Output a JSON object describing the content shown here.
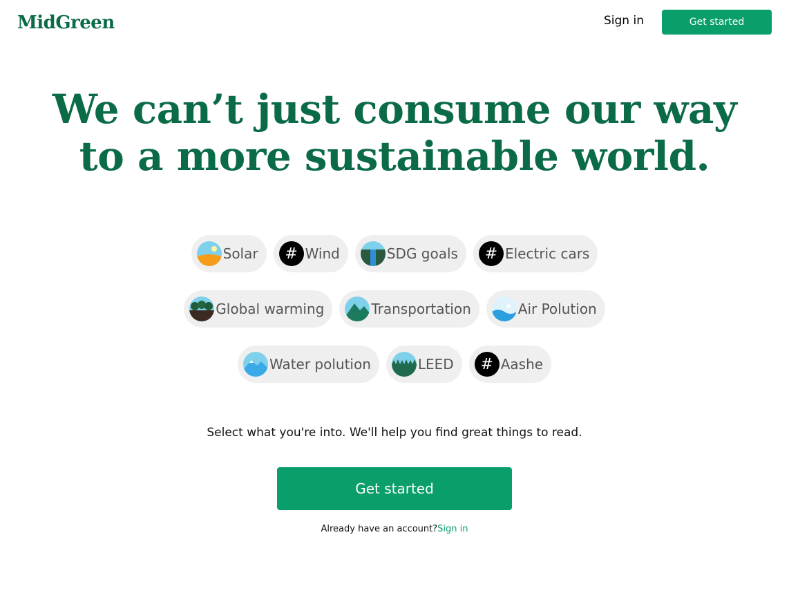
{
  "header": {
    "logo": "MidGreen",
    "signin_label": "Sign in",
    "cta_label": "Get started"
  },
  "hero": {
    "line1": "We can’t just consume our way",
    "line2": "to a more sustainable world."
  },
  "topics": {
    "rows": [
      [
        {
          "label": "Solar",
          "icon": "solar-icon"
        },
        {
          "label": "Wind",
          "icon": "hashtag-icon"
        },
        {
          "label": "SDG goals",
          "icon": "waterfall-icon"
        },
        {
          "label": "Electric cars",
          "icon": "hashtag-icon"
        }
      ],
      [
        {
          "label": "Global warming",
          "icon": "trees-icon"
        },
        {
          "label": "Transportation",
          "icon": "mountain-icon"
        },
        {
          "label": "Air Polution",
          "icon": "waves-icon"
        }
      ],
      [
        {
          "label": "Water polution",
          "icon": "snow-mountain-icon"
        },
        {
          "label": "LEED",
          "icon": "forest-icon"
        },
        {
          "label": "Aashe",
          "icon": "hashtag-icon"
        }
      ]
    ],
    "hash_glyph": "#"
  },
  "prompt": "Select what you're into. We'll help you find great things to read.",
  "main_cta_label": "Get started",
  "account": {
    "text": "Already have an account?",
    "link": "Sign in"
  },
  "colors": {
    "brand": "#0b6b47",
    "accent": "#0a9e6a",
    "chip_bg": "#efefef"
  }
}
